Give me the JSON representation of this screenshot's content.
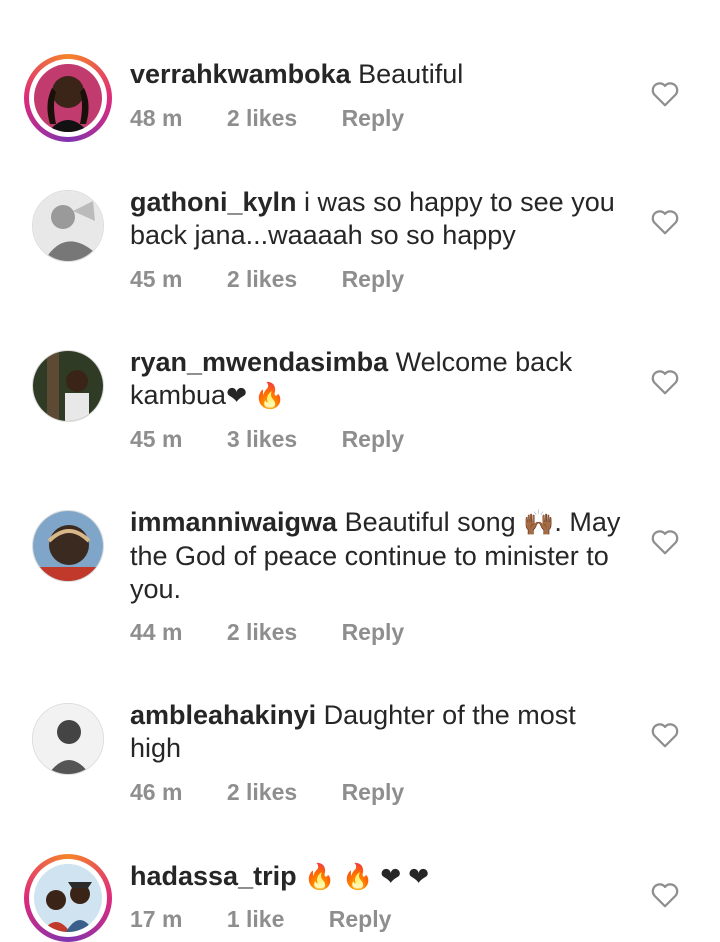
{
  "comments": [
    {
      "username": "verrahkwamboka",
      "text": "Beautiful",
      "time": "48 m",
      "likes": "2 likes",
      "reply": "Reply"
    },
    {
      "username": "gathoni_kyln",
      "text": "i was so happy to see you back jana...waaaah so so happy",
      "time": "45 m",
      "likes": "2 likes",
      "reply": "Reply"
    },
    {
      "username": "ryan_mwendasimba",
      "text": "Welcome back kambua",
      "emoji": "❤ 🔥",
      "time": "45 m",
      "likes": "3 likes",
      "reply": "Reply"
    },
    {
      "username": "immanniwaigwa",
      "text": "Beautiful song",
      "emoji": "🙌🏾",
      "text2": ". May the God of peace continue to minister to you.",
      "time": "44 m",
      "likes": "2 likes",
      "reply": "Reply"
    },
    {
      "username": "ambleahakinyi",
      "text": "Daughter of the most high",
      "time": "46 m",
      "likes": "2 likes",
      "reply": "Reply"
    },
    {
      "username": "hadassa_trip",
      "emoji": "🔥 🔥 ❤ ❤",
      "time": "17 m",
      "likes": "1 like",
      "reply": "Reply"
    }
  ],
  "icons": {
    "like": "heart-outline-icon"
  }
}
